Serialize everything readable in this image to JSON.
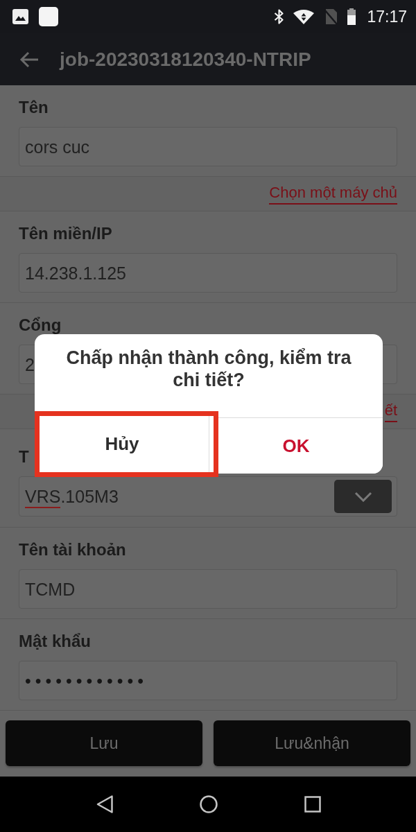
{
  "status_bar": {
    "time": "17:17"
  },
  "app_bar": {
    "title": "job-20230318120340-NTRIP"
  },
  "form": [
    {
      "kind": "field",
      "label": "Tên",
      "value": "cors cuc"
    },
    {
      "kind": "link",
      "text": "Chọn một máy chủ"
    },
    {
      "kind": "field",
      "label": "Tên miền/IP",
      "value": "14.238.1.125"
    },
    {
      "kind": "field",
      "label": "Cổng",
      "value": "2"
    },
    {
      "kind": "link",
      "text": "ết"
    },
    {
      "kind": "dropdown",
      "label": "T",
      "value_parts": [
        {
          "text": "VRS",
          "misspelled": true
        },
        {
          "text": ".105M3",
          "misspelled": false
        }
      ]
    },
    {
      "kind": "field",
      "label": "Tên tài khoản",
      "value": "TCMD"
    },
    {
      "kind": "password",
      "label": "Mật khẩu",
      "value": "••••••••••••"
    }
  ],
  "actions": [
    "Lưu",
    "Lưu&nhận"
  ],
  "dialog": {
    "message": "Chấp nhận thành công, kiểm tra chi tiết?",
    "buttons": [
      {
        "label": "Hủy",
        "kind": "cancel",
        "highlighted": true
      },
      {
        "label": "OK",
        "kind": "confirm",
        "highlighted": false
      }
    ]
  }
}
